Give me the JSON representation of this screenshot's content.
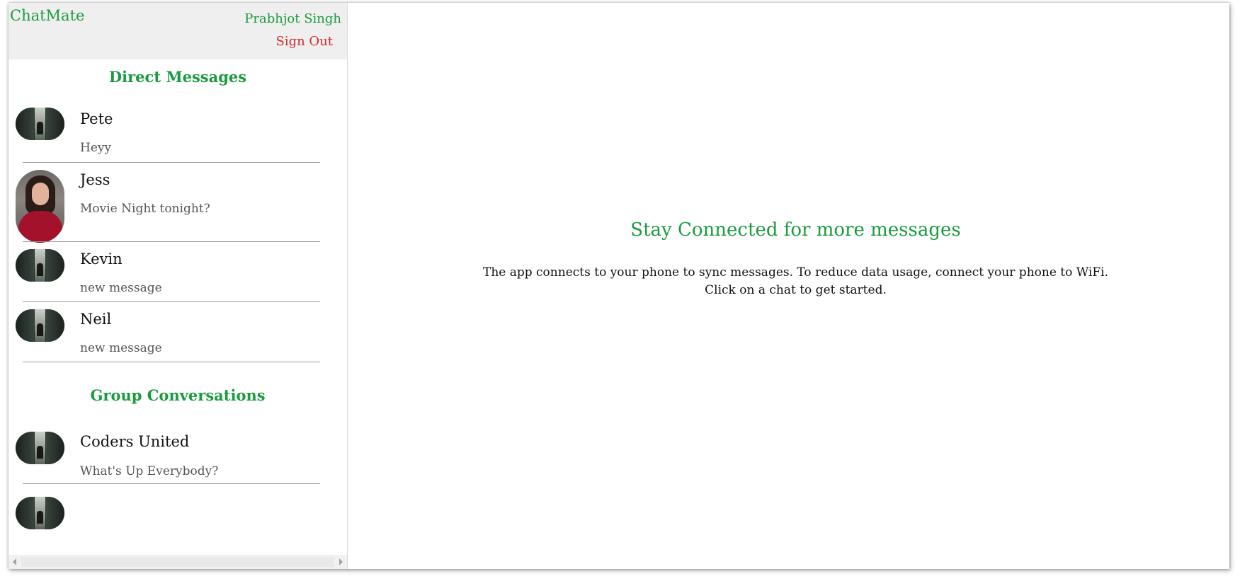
{
  "header": {
    "brand": "ChatMate",
    "user_name": "Prabhjot Singh",
    "sign_out_label": "Sign Out"
  },
  "direct_messages": {
    "title": "Direct Messages",
    "chats": [
      {
        "name": "Pete",
        "preview": "Heyy",
        "avatar": "waterfall-photo"
      },
      {
        "name": "Jess",
        "preview": "Movie Night tonight?",
        "avatar": "woman-portrait-photo"
      },
      {
        "name": "Kevin",
        "preview": "new message",
        "avatar": "waterfall-photo"
      },
      {
        "name": "Neil",
        "preview": "new message",
        "avatar": "waterfall-photo"
      }
    ]
  },
  "group_conversations": {
    "title": "Group Conversations",
    "chats": [
      {
        "name": "Coders United",
        "preview": "What's Up Everybody?",
        "avatar": "waterfall-photo"
      }
    ]
  },
  "main": {
    "title": "Stay Connected for more messages",
    "line1": "The app connects to your phone to sync messages. To reduce data usage, connect your phone to WiFi.",
    "line2": "Click on a chat to get started."
  },
  "colors": {
    "accent": "#1a9b3f",
    "sign_out": "#d12a2a",
    "topbar_bg": "#efefef"
  }
}
